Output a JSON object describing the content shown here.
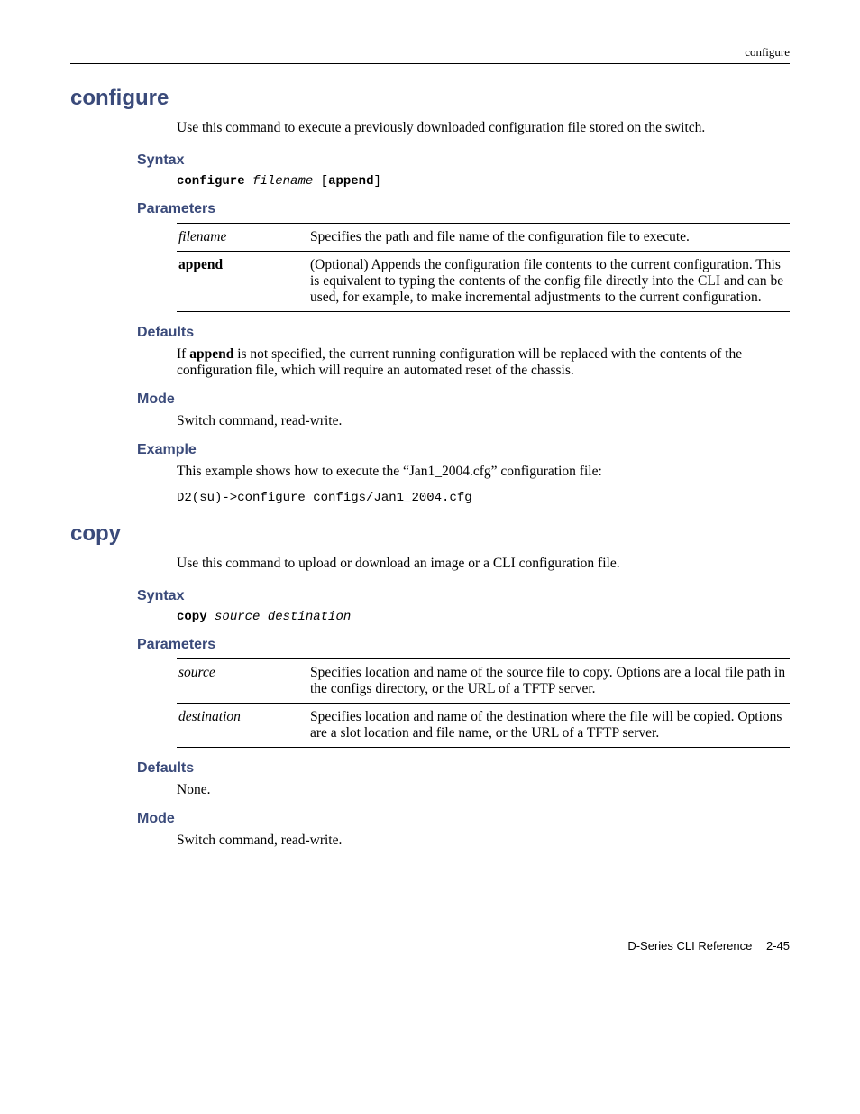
{
  "header": {
    "right": "configure"
  },
  "sections": {
    "configure": {
      "title": "configure",
      "intro": "Use this command to execute a previously downloaded configuration file stored on the switch.",
      "syntax_label": "Syntax",
      "syntax": {
        "cmd": "configure",
        "arg": "filename",
        "opt_open": " [",
        "opt_kw": "append",
        "opt_close": "]"
      },
      "parameters_label": "Parameters",
      "params": [
        {
          "name": "filename",
          "style": "italic",
          "desc": "Specifies the path and file name of the configuration file to execute."
        },
        {
          "name": "append",
          "style": "bold",
          "desc": "(Optional) Appends the configuration file contents to the current configuration. This is equivalent to typing the contents of the config file directly into the CLI and can be used, for example, to make incremental adjustments to the current configuration."
        }
      ],
      "defaults_label": "Defaults",
      "defaults_pre": "If ",
      "defaults_kw": "append",
      "defaults_post": " is not specified, the current running configuration will be replaced with the contents of the configuration file, which will require an automated reset of the chassis.",
      "mode_label": "Mode",
      "mode": "Switch command, read-write.",
      "example_label": "Example",
      "example_text": "This example shows how to execute the “Jan1_2004.cfg” configuration file:",
      "example_code": "D2(su)->configure configs/Jan1_2004.cfg"
    },
    "copy": {
      "title": "copy",
      "intro": "Use this command to upload or download an image or a CLI configuration file.",
      "syntax_label": "Syntax",
      "syntax": {
        "cmd": "copy",
        "args": "source destination"
      },
      "parameters_label": "Parameters",
      "params": [
        {
          "name": "source",
          "style": "italic",
          "desc": "Specifies location and name of the source file to copy. Options are a local file path in the configs directory, or the URL of a TFTP server."
        },
        {
          "name": "destination",
          "style": "italic",
          "desc": "Specifies location and name of the destination where the file will be copied. Options are a slot location and file name, or the URL of a TFTP server."
        }
      ],
      "defaults_label": "Defaults",
      "defaults_text": "None.",
      "mode_label": "Mode",
      "mode": "Switch command, read-write."
    }
  },
  "footer": {
    "book": "D-Series CLI Reference",
    "page": "2-45"
  }
}
